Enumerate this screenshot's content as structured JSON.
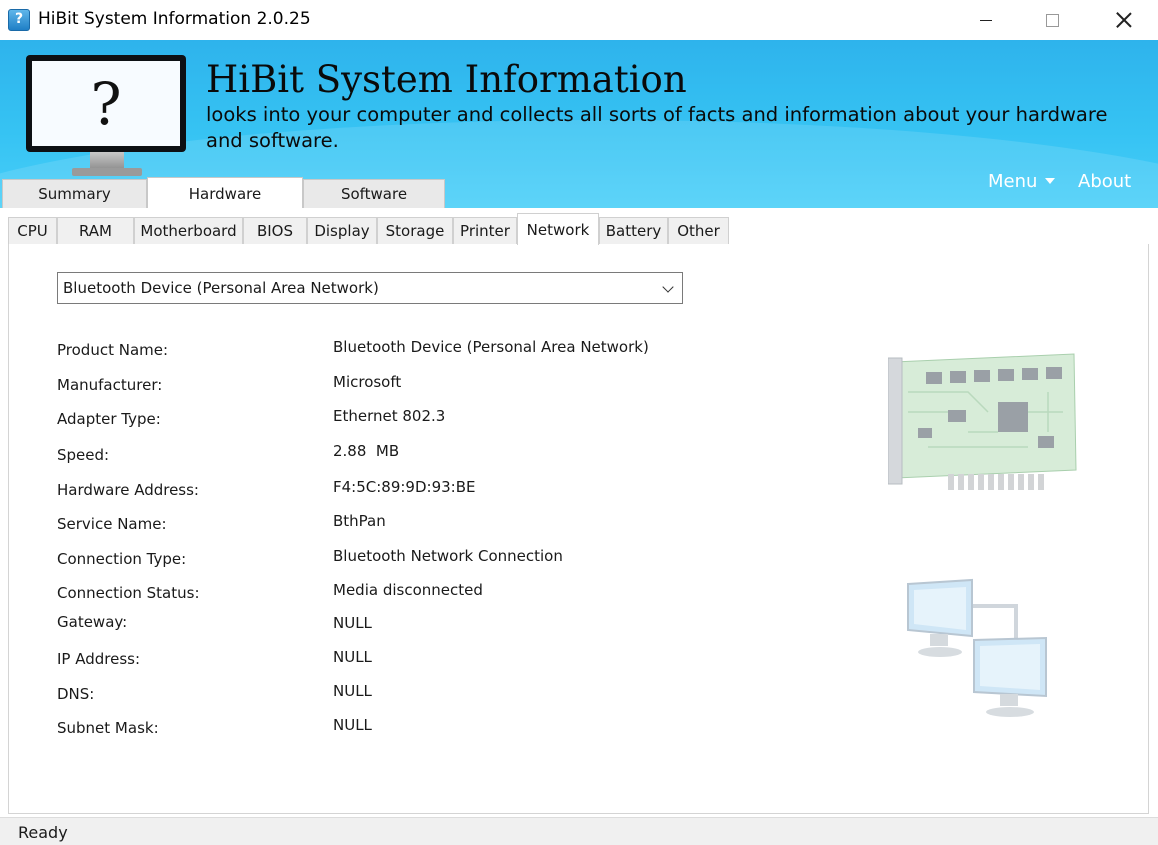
{
  "window": {
    "title": "HiBit System Information 2.0.25"
  },
  "banner": {
    "title": "HiBit System Information",
    "subtitle_line1": "looks into your computer and collects all sorts of facts and information about your hardware",
    "subtitle_line2": "and software.",
    "monitor_glyph": "?",
    "menu_label": "Menu",
    "about_label": "About"
  },
  "main_tabs": [
    {
      "label": "Summary"
    },
    {
      "label": "Hardware",
      "active": true
    },
    {
      "label": "Software"
    }
  ],
  "sub_tabs": [
    {
      "label": "CPU"
    },
    {
      "label": "RAM"
    },
    {
      "label": "Motherboard"
    },
    {
      "label": "BIOS"
    },
    {
      "label": "Display"
    },
    {
      "label": "Storage"
    },
    {
      "label": "Printer"
    },
    {
      "label": "Network",
      "active": true
    },
    {
      "label": "Battery"
    },
    {
      "label": "Other"
    }
  ],
  "device_select": {
    "value": "Bluetooth Device (Personal Area Network)"
  },
  "fields": [
    {
      "label": "Product Name:",
      "value": "Bluetooth Device (Personal Area Network)"
    },
    {
      "label": "Manufacturer:",
      "value": "Microsoft"
    },
    {
      "label": "Adapter Type:",
      "value": "Ethernet 802.3"
    },
    {
      "label": "Speed:",
      "value": "2.88  MB"
    },
    {
      "label": "Hardware Address:",
      "value": "F4:5C:89:9D:93:BE"
    },
    {
      "label": "Service Name:",
      "value": "BthPan"
    },
    {
      "label": "Connection Type:",
      "value": "Bluetooth Network Connection"
    },
    {
      "label": "Connection Status:",
      "value": "Media disconnected"
    },
    {
      "label": "Gateway:",
      "value": "NULL"
    },
    {
      "label": "IP Address:",
      "value": "NULL"
    },
    {
      "label": "DNS:",
      "value": "NULL"
    },
    {
      "label": "Subnet Mask:",
      "value": "NULL"
    }
  ],
  "status": {
    "text": "Ready"
  },
  "icons": {
    "app": "app-question-monitor-icon",
    "network_card": "network-card-icon",
    "network_computers": "networked-computers-icon"
  },
  "colors": {
    "banner": "#36c3f3",
    "banner_text": "#0a0a0a",
    "menu_text": "#ffffff"
  }
}
